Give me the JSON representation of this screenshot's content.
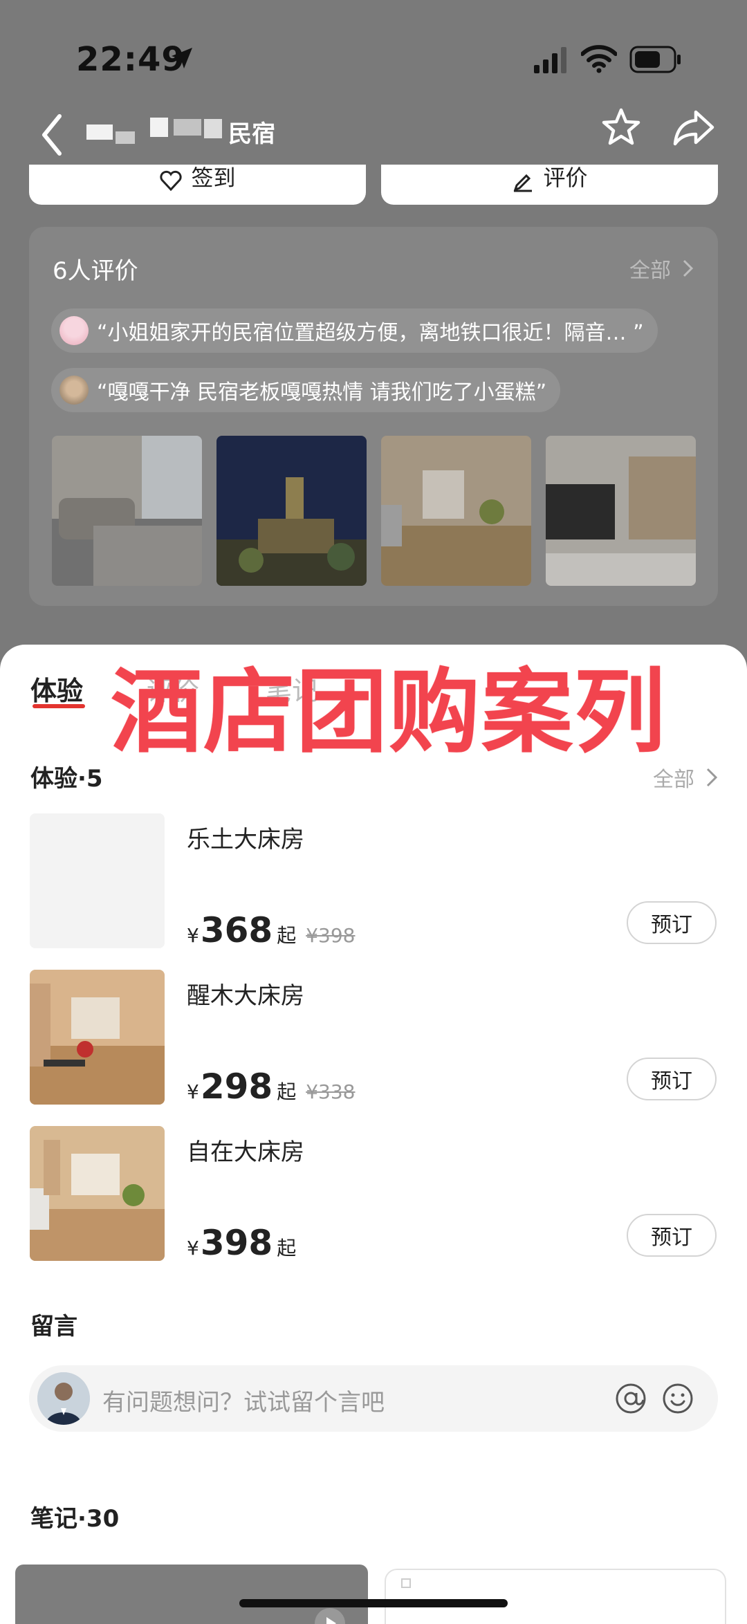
{
  "status_bar": {
    "time": "22:49"
  },
  "nav": {
    "title": "民宿"
  },
  "top_actions": {
    "checkin_label": "签到",
    "review_label": "评价"
  },
  "reviews": {
    "title": "6人评价",
    "all_label": "全部",
    "quotes": [
      "“小姐姐家开的民宿位置超级方便，离地铁口很近！隔音… ”",
      "“嘎嘎干净 民宿老板嘎嘎热情 请我们吃了小蛋糕”"
    ]
  },
  "overlay": {
    "title": "酒店团购案列"
  },
  "tabs": [
    "体验",
    "评价",
    "笔记"
  ],
  "experiences": {
    "title": "体验·5",
    "all_label": "全部",
    "rooms": [
      {
        "name": "乐土大床房",
        "currency": "¥",
        "price": "368",
        "suffix": "起",
        "original": "¥398",
        "book_label": "预订"
      },
      {
        "name": "醒木大床房",
        "currency": "¥",
        "price": "298",
        "suffix": "起",
        "original": "¥338",
        "book_label": "预订"
      },
      {
        "name": "自在大床房",
        "currency": "¥",
        "price": "398",
        "suffix": "起",
        "original": "",
        "book_label": "预订"
      }
    ]
  },
  "messages": {
    "title": "留言",
    "placeholder": "有问题想问？试试留个言吧"
  },
  "notes": {
    "title": "笔记·30"
  }
}
